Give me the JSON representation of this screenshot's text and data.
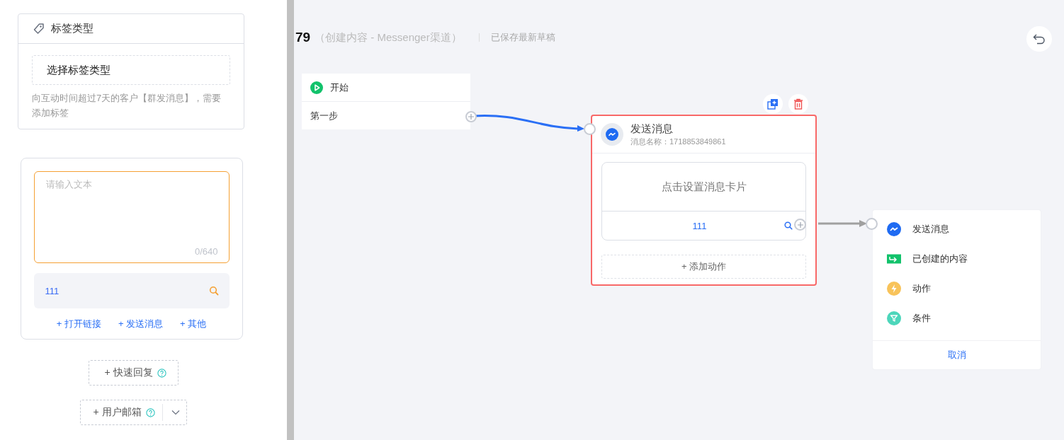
{
  "sidebar": {
    "tag_card": {
      "title": "标签类型",
      "select": {
        "placeholder": "选择标签类型"
      },
      "hint": "向互动时间超过7天的客户【群发消息】，需要添加标签"
    },
    "message_card": {
      "textarea": {
        "placeholder": "请输入文本",
        "counter": "0/640"
      },
      "button_item": {
        "label": "111"
      },
      "links": [
        "+ 打开链接",
        "+ 发送消息",
        "+ 其他"
      ]
    },
    "quick_reply": {
      "label": "+ 快速回复"
    },
    "user_email": {
      "label": "+ 用户邮箱"
    }
  },
  "header": {
    "title": "79",
    "subtitle": "（创建内容 - Messenger渠道）",
    "status": "已保存最新草稿"
  },
  "start_node": {
    "title": "开始",
    "step": "第一步"
  },
  "message_node": {
    "title": "发送消息",
    "subtitle": "消息名称：1718853849861",
    "card_prompt": "点击设置消息卡片",
    "card_button": "111",
    "add_action": "+ 添加动作",
    "selected": true
  },
  "menu": {
    "items": [
      {
        "kind": "messenger",
        "label": "发送消息"
      },
      {
        "kind": "content",
        "label": "已创建的内容"
      },
      {
        "kind": "action",
        "label": "动作"
      },
      {
        "kind": "condition",
        "label": "条件"
      }
    ],
    "cancel": "取消"
  }
}
